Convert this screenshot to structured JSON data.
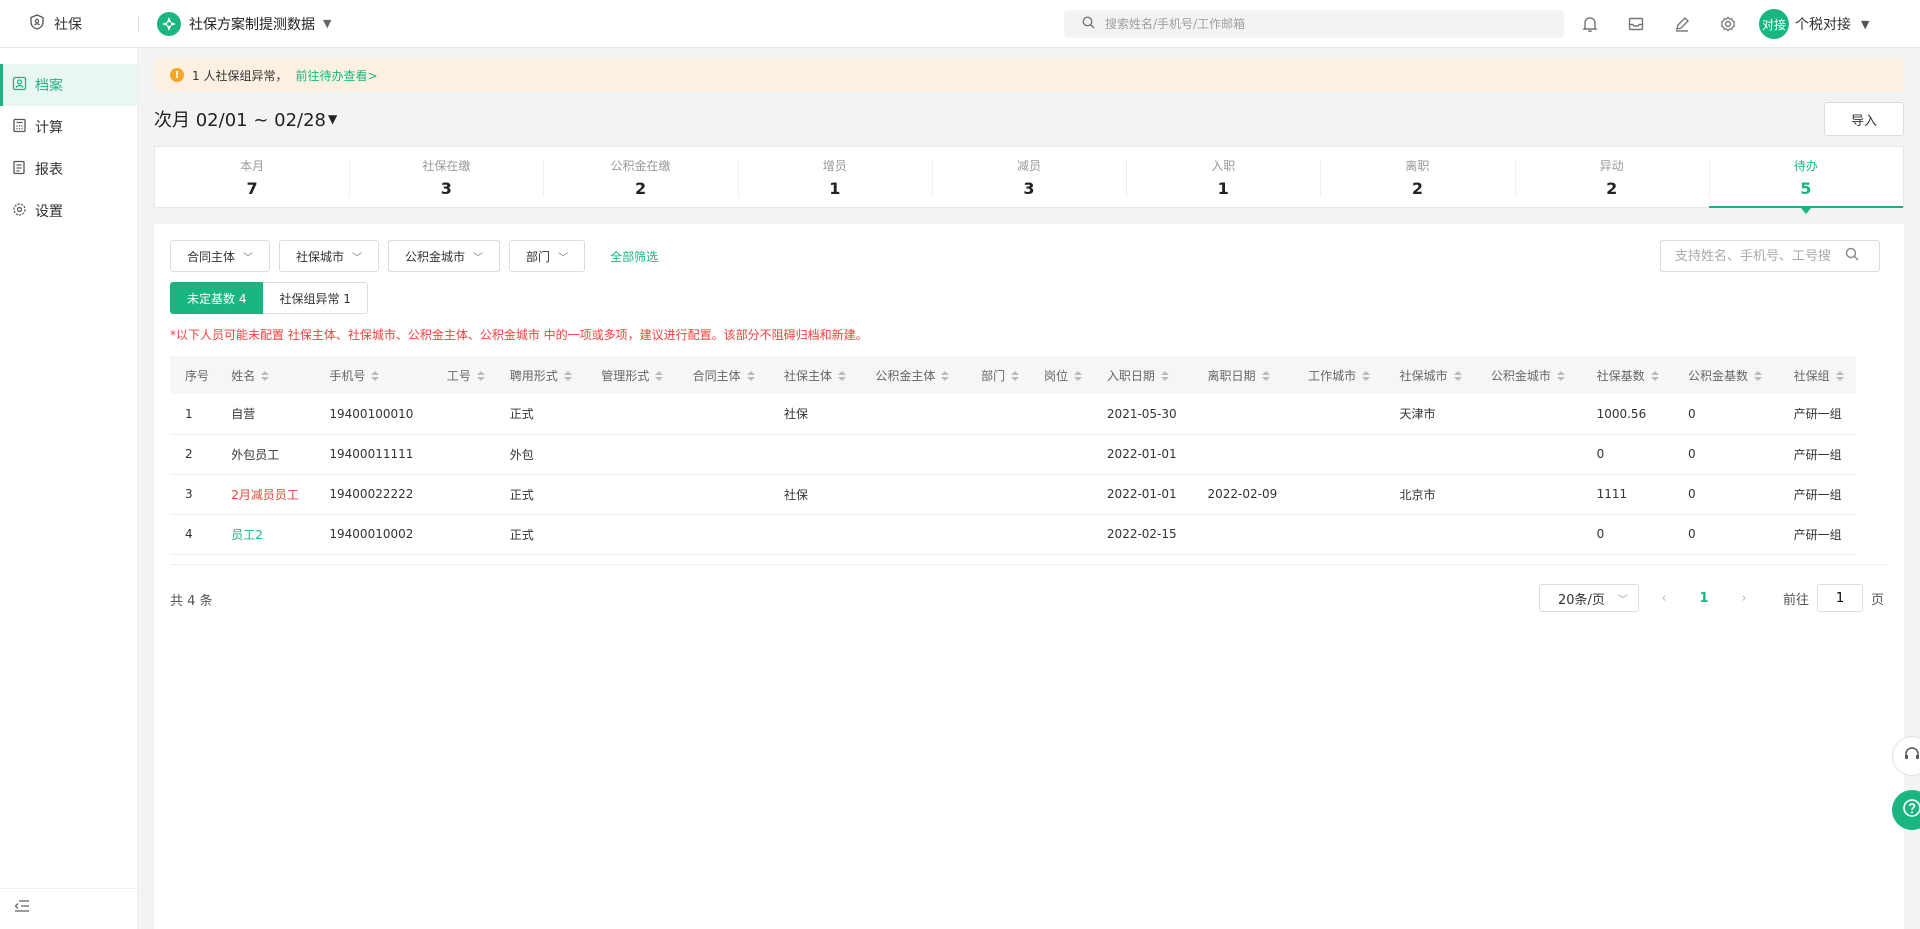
{
  "app": {
    "name": "社保"
  },
  "plan": {
    "title": "社保方案制提测数据"
  },
  "search": {
    "placeholder": "搜索姓名/手机号/工作邮箱"
  },
  "user": {
    "avatar_text": "对接",
    "name": "个税对接"
  },
  "sidebar": {
    "items": [
      {
        "label": "档案",
        "icon": "profile-icon"
      },
      {
        "label": "计算",
        "icon": "calculator-icon"
      },
      {
        "label": "报表",
        "icon": "report-icon"
      },
      {
        "label": "设置",
        "icon": "gear-icon"
      }
    ]
  },
  "alert": {
    "text": "1 人社保组异常，",
    "link": "前往待办查看>"
  },
  "period": {
    "label": "次月 02/01 ~ 02/28"
  },
  "import_label": "导入",
  "stats": [
    {
      "label": "本月",
      "value": "7"
    },
    {
      "label": "社保在缴",
      "value": "3"
    },
    {
      "label": "公积金在缴",
      "value": "2"
    },
    {
      "label": "增员",
      "value": "1"
    },
    {
      "label": "减员",
      "value": "3"
    },
    {
      "label": "入职",
      "value": "1"
    },
    {
      "label": "离职",
      "value": "2"
    },
    {
      "label": "异动",
      "value": "2"
    },
    {
      "label": "待办",
      "value": "5"
    }
  ],
  "filters": [
    "合同主体",
    "社保城市",
    "公积金城市",
    "部门"
  ],
  "all_filter": "全部筛选",
  "panel_search": {
    "placeholder": "支持姓名、手机号、工号搜"
  },
  "tabs": [
    "未定基数 4",
    "社保组异常 1"
  ],
  "warning": "*以下人员可能未配置 社保主体、社保城市、公积金主体、公积金城市 中的一项或多项，建议进行配置。该部分不阻碍归档和新建。",
  "table": {
    "columns": [
      "序号",
      "姓名",
      "手机号",
      "工号",
      "聘用形式",
      "管理形式",
      "合同主体",
      "社保主体",
      "公积金主体",
      "部门",
      "岗位",
      "入职日期",
      "离职日期",
      "工作城市",
      "社保城市",
      "公积金城市",
      "社保基数",
      "公积金基数",
      "社保组"
    ],
    "rows": [
      [
        "1",
        "自营",
        "19400100010",
        "",
        "正式",
        "",
        "",
        "社保",
        "",
        "",
        "",
        "2021-05-30",
        "",
        "",
        "天津市",
        "",
        "1000.56",
        "0",
        "产研一组"
      ],
      [
        "2",
        "外包员工",
        "19400011111",
        "",
        "外包",
        "",
        "",
        "",
        "",
        "",
        "",
        "2022-01-01",
        "",
        "",
        "",
        "",
        "0",
        "0",
        "产研一组"
      ],
      [
        "3",
        "2月减员员工",
        "19400022222",
        "",
        "正式",
        "",
        "",
        "社保",
        "",
        "",
        "",
        "2022-01-01",
        "2022-02-09",
        "",
        "北京市",
        "",
        "1111",
        "0",
        "产研一组"
      ],
      [
        "4",
        "员工2",
        "19400010002",
        "",
        "正式",
        "",
        "",
        "",
        "",
        "",
        "",
        "2022-02-15",
        "",
        "",
        "",
        "",
        "0",
        "0",
        "产研一组"
      ]
    ]
  },
  "total": "共 4 条",
  "pager": {
    "page_size": "20条/页",
    "current": "1",
    "goto_label": "前往",
    "goto_value": "1",
    "page_suffix": "页"
  },
  "colors": {
    "accent": "#1bb580",
    "danger": "#f0433b",
    "alert_bg": "#fcf0e3"
  }
}
